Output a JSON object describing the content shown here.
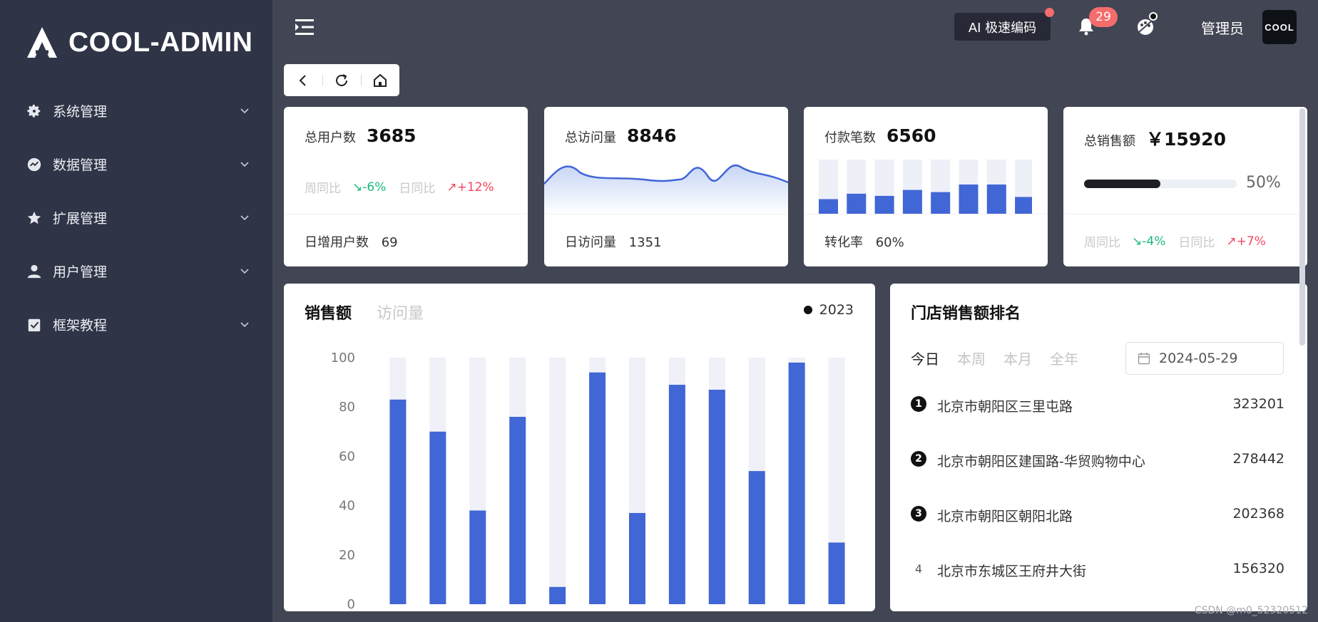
{
  "brand": {
    "name": "COOL-ADMIN"
  },
  "sidebar": {
    "items": [
      {
        "label": "系统管理",
        "icon": "gear-icon"
      },
      {
        "label": "数据管理",
        "icon": "chart-icon"
      },
      {
        "label": "扩展管理",
        "icon": "star-icon"
      },
      {
        "label": "用户管理",
        "icon": "user-icon"
      },
      {
        "label": "框架教程",
        "icon": "doc-icon"
      }
    ]
  },
  "topbar": {
    "ai_label": "AI 极速编码",
    "notification_count": "29",
    "user_name": "管理员",
    "avatar_text": "COOL"
  },
  "stats": {
    "users": {
      "title": "总用户数",
      "value": "3685",
      "week_label": "周同比",
      "week_value": "↘-6%",
      "day_label": "日同比",
      "day_value": "↗+12%",
      "foot_label": "日增用户数",
      "foot_value": "69"
    },
    "visits": {
      "title": "总访问量",
      "value": "8846",
      "foot_label": "日访问量",
      "foot_value": "1351"
    },
    "payments": {
      "title": "付款笔数",
      "value": "6560",
      "foot_label": "转化率",
      "foot_value": "60%",
      "bars": [
        0.27,
        0.37,
        0.33,
        0.44,
        0.4,
        0.54,
        0.54,
        0.31
      ]
    },
    "sales": {
      "title": "总销售额",
      "value": "￥15920",
      "progress": 0.5,
      "progress_label": "50%",
      "week_label": "周同比",
      "week_value": "↘-4%",
      "day_label": "日同比",
      "day_value": "↗+7%"
    }
  },
  "sales_chart": {
    "tabs": [
      "销售额",
      "访问量"
    ],
    "legend": "2023"
  },
  "chart_data": {
    "type": "bar",
    "series": [
      {
        "name": "2023",
        "values": [
          83,
          70,
          38,
          76,
          7,
          94,
          37,
          89,
          87,
          54,
          98,
          25
        ]
      }
    ],
    "ylim": [
      0,
      100
    ],
    "yticks": [
      "0",
      "20",
      "40",
      "60",
      "80",
      "100"
    ],
    "colors": {
      "bar": "#4166d5",
      "background": "#f0f0f8"
    }
  },
  "ranking": {
    "title": "门店销售额排名",
    "tabs": [
      "今日",
      "本周",
      "本月",
      "全年"
    ],
    "date": "2024-05-29",
    "items": [
      {
        "rank": "1",
        "name": "北京市朝阳区三里屯路",
        "value": "323201"
      },
      {
        "rank": "2",
        "name": "北京市朝阳区建国路-华贸购物中心",
        "value": "278442"
      },
      {
        "rank": "3",
        "name": "北京市朝阳区朝阳北路",
        "value": "202368"
      },
      {
        "rank": "4",
        "name": "北京市东城区王府井大街",
        "value": "156320"
      }
    ]
  },
  "watermark": "CSDN @m0_52320512"
}
